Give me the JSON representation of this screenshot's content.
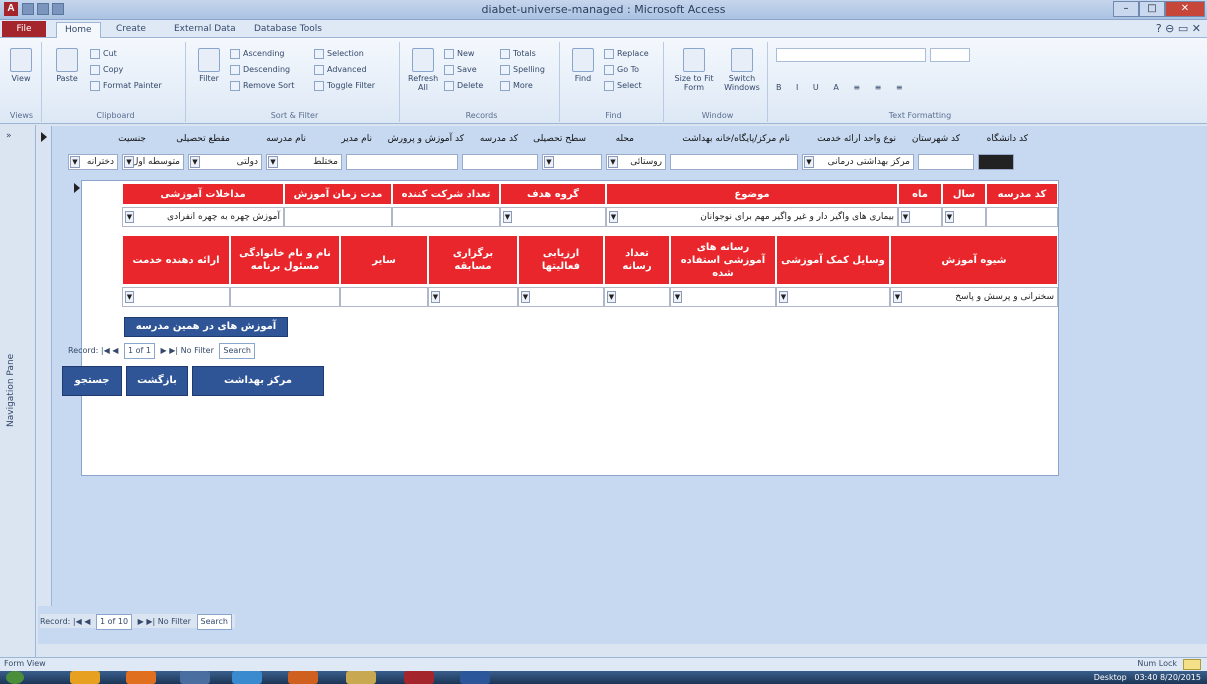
{
  "window": {
    "title": "diabet-universe-managed : Microsoft Access",
    "file_tab": "File",
    "help_icon": "help-icon"
  },
  "ribbon": {
    "tabs": [
      "Home",
      "Create",
      "External Data",
      "Database Tools"
    ],
    "groups": {
      "views": {
        "name": "Views",
        "view_label": "View"
      },
      "clipboard": {
        "name": "Clipboard",
        "paste": "Paste",
        "cut": "Cut",
        "copy": "Copy",
        "format_painter": "Format Painter"
      },
      "sort_filter": {
        "name": "Sort & Filter",
        "filter": "Filter",
        "ascending": "Ascending",
        "descending": "Descending",
        "remove_sort": "Remove Sort",
        "selection": "Selection",
        "advanced": "Advanced",
        "toggle_filter": "Toggle Filter"
      },
      "records": {
        "name": "Records",
        "refresh": "Refresh All",
        "new": "New",
        "save": "Save",
        "delete": "Delete",
        "totals": "Totals",
        "spelling": "Spelling",
        "more": "More"
      },
      "find": {
        "name": "Find",
        "find": "Find",
        "replace": "Replace",
        "goto": "Go To",
        "select": "Select"
      },
      "window": {
        "name": "Window",
        "size_to_fit": "Size to Fit Form",
        "switch": "Switch Windows"
      },
      "text_formatting": {
        "name": "Text Formatting"
      }
    }
  },
  "navpane": {
    "label": "Navigation Pane"
  },
  "header_form": {
    "labels": [
      "کد دانشگاه",
      "کد شهرستان",
      "نوع واحد ارائه خدمت",
      "نام مرکز/پایگاه/خانه بهداشت",
      "محله",
      "سطح تحصیلی",
      "کد مدرسه",
      "کد آموزش و پرورش",
      "نام مدیر",
      "نام مدرسه",
      "مقطع تحصیلی",
      "جنسیت"
    ],
    "fields": [
      {
        "value": ""
      },
      {
        "value": "مرکز بهداشتی درمانی"
      },
      {
        "value": ""
      },
      {
        "value": "روستائی"
      },
      {
        "value": ""
      },
      {
        "value": ""
      },
      {
        "value": "مختلط"
      },
      {
        "value": ""
      },
      {
        "value": "متوسطه اول"
      },
      {
        "value": "دولتی"
      },
      {
        "value": "دخترانه"
      }
    ]
  },
  "subform": {
    "row1_headers": [
      "کد مدرسه",
      "سال",
      "ماه",
      "موضوع",
      "گروه هدف",
      "تعداد شرکت کننده",
      "مدت زمان آموزش",
      "مداخلات آموزشی"
    ],
    "row1_values": {
      "school_code": "",
      "year": "",
      "month": "",
      "topic": "بیماری های واگیر دار و غیر واگیر مهم برای نوجوانان",
      "target": "",
      "participants": "",
      "duration": "",
      "intervention": "آموزش چهره به چهره انفرادی"
    },
    "row2_headers": [
      "شیوه آموزش",
      "وسایل کمک آموزشی",
      "رسانه های آموزشی استفاده شده",
      "تعداد رسانه",
      "ارزیابی فعالیتها",
      "برگزاری مسابقه",
      "سایر",
      "نام و نام خانوادگی مسئول برنامه",
      "ارائه دهنده خدمت"
    ],
    "row2_values": {
      "method": "سخنرانی و پرسش و پاسخ",
      "aids": "",
      "media": "",
      "media_count": "",
      "eval": "",
      "contest": "",
      "other": "",
      "responsible": "",
      "provider": ""
    },
    "school_btn": "آموزش های در همین مدرسه",
    "recnav": {
      "label": "Record:",
      "current": "1 of 1",
      "filter": "No Filter",
      "search": "Search"
    }
  },
  "bottom_buttons": [
    "مرکز بهداشت",
    "بازگشت",
    "جستجو"
  ],
  "form_recnav": {
    "label": "Record:",
    "current": "1 of 10",
    "filter": "No Filter",
    "search": "Search"
  },
  "statusbar": {
    "left": "Form View",
    "right": "Num Lock"
  },
  "taskbar": {
    "desktop": "Desktop",
    "time": "03:40",
    "date": "8/20/2015"
  }
}
